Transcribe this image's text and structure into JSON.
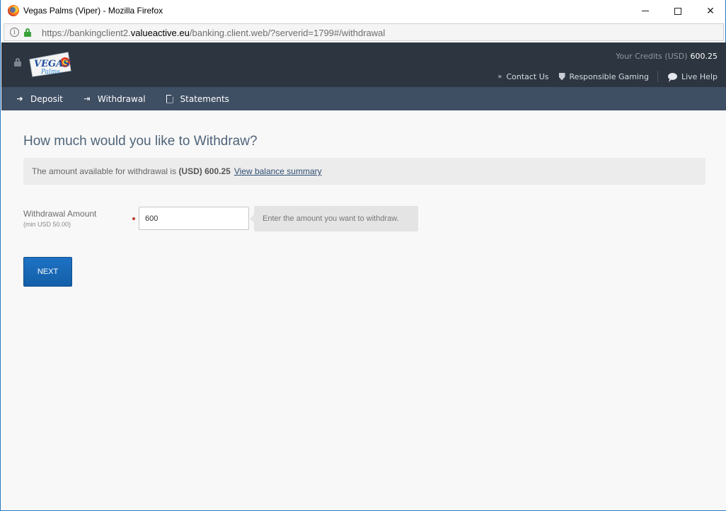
{
  "window": {
    "title": "Vegas Palms (Viper) - Mozilla Firefox",
    "icon": "firefox-icon"
  },
  "urlbar": {
    "url_prefix": "https://bankingclient2.",
    "url_domain": "valueactive.eu",
    "url_suffix": "/banking.client.web/?serverid=1799#/withdrawal"
  },
  "header": {
    "logo_text": "VEGAS Palms",
    "credits_label": "Your Credits (USD)",
    "credits_value": "600.25",
    "links": {
      "contact": "Contact Us",
      "responsible": "Responsible Gaming",
      "live_help": "Live Help"
    }
  },
  "nav": {
    "deposit": "Deposit",
    "withdrawal": "Withdrawal",
    "statements": "Statements"
  },
  "main": {
    "title": "How much would you like to Withdraw?",
    "available_text": "The amount available for withdrawal is ",
    "available_amount": "(USD) 600.25",
    "balance_link": "View balance summary",
    "amount_label": "Withdrawal Amount",
    "amount_min": "(min USD 50.00)",
    "amount_value": "600",
    "hint": "Enter the amount you want to withdraw.",
    "next_label": "NEXT"
  },
  "colors": {
    "header_bg": "#2c3540",
    "nav_bg": "#3e4e63",
    "button_blue": "#1a6bbb",
    "title_color": "#4f6479"
  }
}
